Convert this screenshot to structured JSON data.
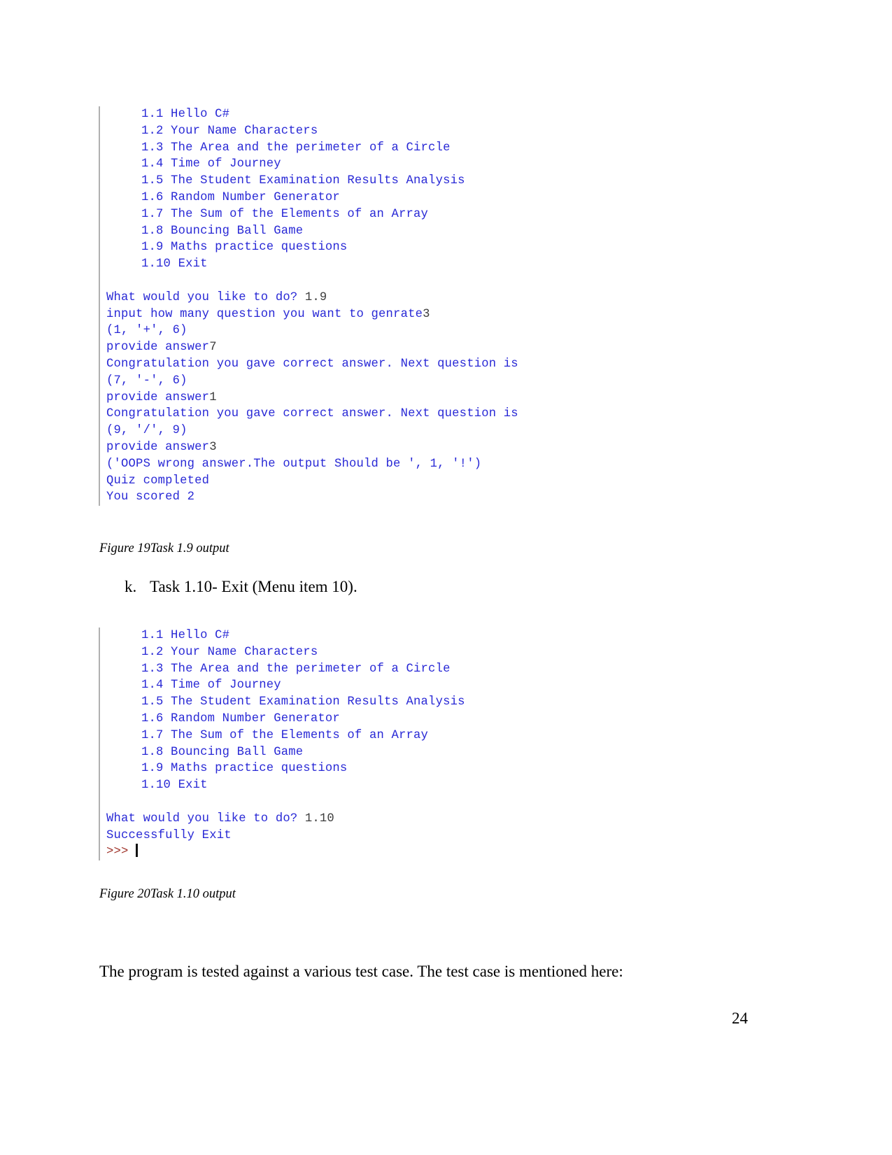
{
  "page": {
    "number": "24",
    "body_paragraph": "The program is tested against a various test case. The test case is mentioned here:"
  },
  "menu": {
    "items": [
      "1.1 Hello C#",
      "1.2 Your Name Characters",
      "1.3 The Area and the perimeter of a Circle",
      "1.4 Time of Journey",
      "1.5 The Student Examination Results Analysis",
      "1.6 Random Number Generator",
      "1.7 The Sum of the Elements of an Array",
      "1.8 Bouncing Ball Game",
      "1.9 Maths practice questions",
      "1.10 Exit"
    ]
  },
  "console_one": {
    "lines": [
      {
        "out": "What would you like to do? ",
        "inp": "1.9"
      },
      {
        "out": "input how many question you want to genrate",
        "inp": "3"
      },
      {
        "out": "(1, '+', 6)",
        "inp": ""
      },
      {
        "out": "provide answer",
        "inp": "7"
      },
      {
        "out": "Congratulation you gave correct answer. Next question is",
        "inp": ""
      },
      {
        "out": "(7, '-', 6)",
        "inp": ""
      },
      {
        "out": "provide answer",
        "inp": "1"
      },
      {
        "out": "Congratulation you gave correct answer. Next question is",
        "inp": ""
      },
      {
        "out": "(9, '/', 9)",
        "inp": ""
      },
      {
        "out": "provide answer",
        "inp": "3"
      },
      {
        "out": "('OOPS wrong answer.The output Should be ', 1, '!')",
        "inp": ""
      },
      {
        "out": "Quiz completed",
        "inp": ""
      },
      {
        "out": "You scored 2",
        "inp": ""
      }
    ]
  },
  "console_two": {
    "lines": [
      {
        "out": "What would you like to do? ",
        "inp": "1.10"
      },
      {
        "out": "Successfully Exit",
        "inp": ""
      }
    ],
    "prompt": ">>>"
  },
  "caption_figure_19": "Figure 19Task 1.9 output",
  "caption_figure_20": "Figure 20Task 1.10 output",
  "task_item": {
    "marker": "k.",
    "text": "Task 1.10- Exit (Menu item 10)."
  },
  "colors": {
    "output_text": "#2929d6",
    "input_text": "#3c3c3c",
    "prompt_text": "#a0342b",
    "block_border": "#b0b0b0",
    "body_text": "#000000"
  }
}
